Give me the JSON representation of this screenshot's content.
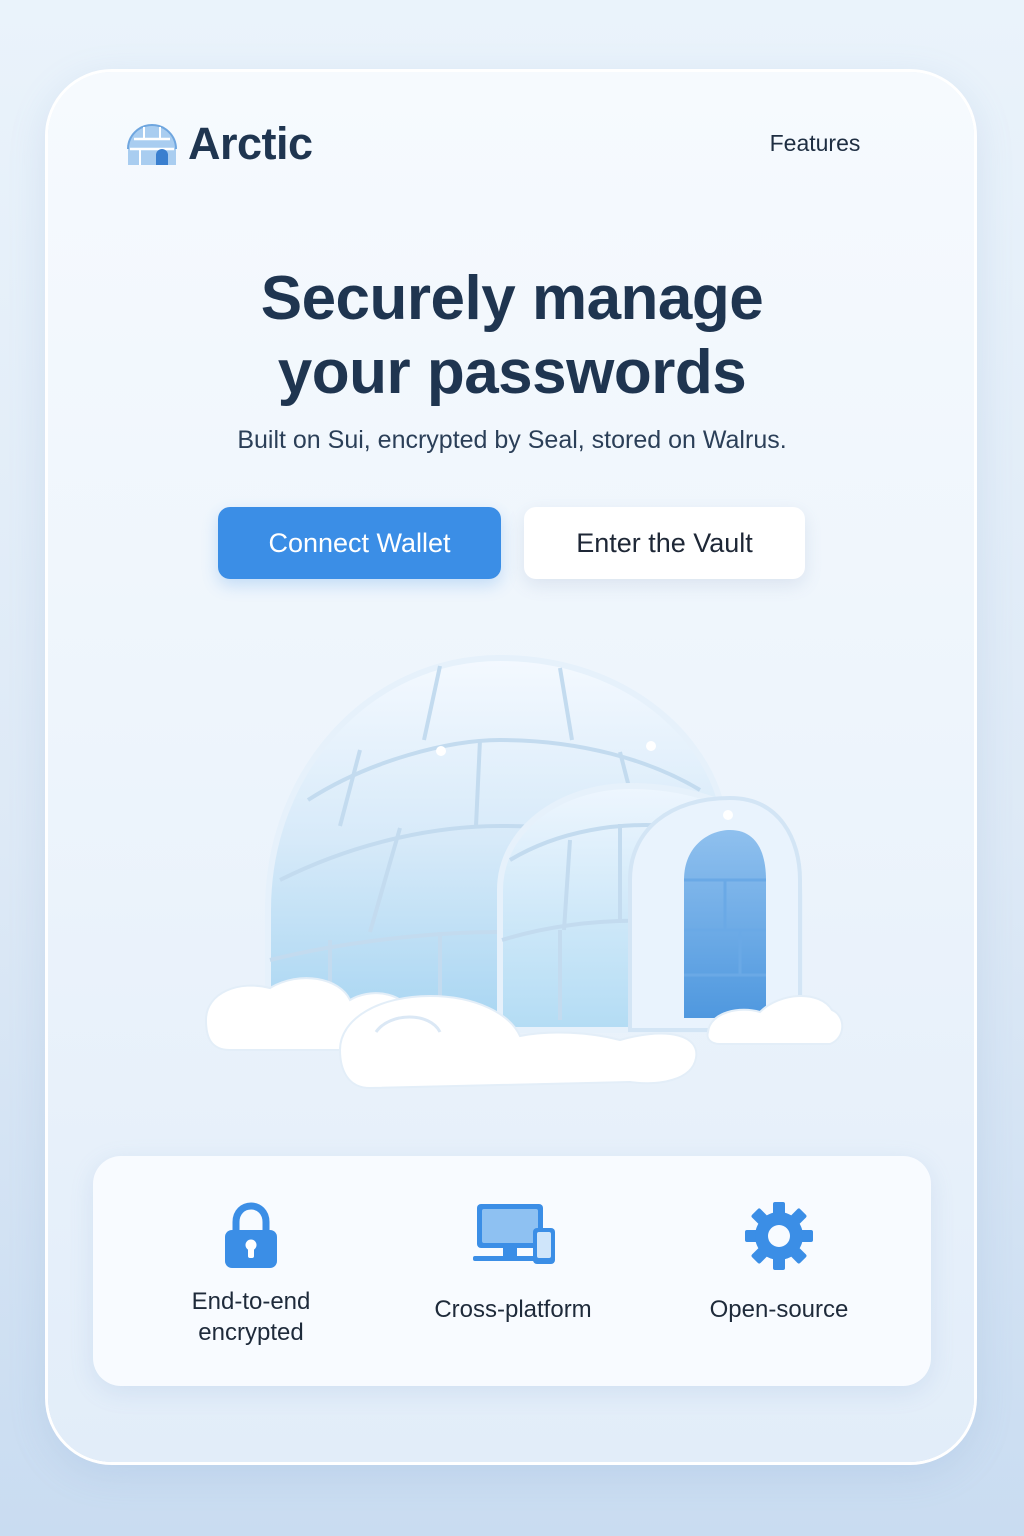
{
  "brand": {
    "name": "Arctic",
    "logo_icon": "igloo-logo-icon"
  },
  "nav": {
    "features_label": "Features"
  },
  "hero": {
    "title_line1": "Securely manage",
    "title_line2": "your passwords",
    "subtitle": "Built on Sui, encrypted by Seal, stored on Walrus."
  },
  "actions": {
    "primary_label": "Connect Wallet",
    "secondary_label": "Enter the Vault"
  },
  "illustration": {
    "icon": "igloo-illustration"
  },
  "features": [
    {
      "icon": "lock-icon",
      "label": "End-to-end encrypted",
      "line1": "End-to-end",
      "line2": "encrypted"
    },
    {
      "icon": "devices-icon",
      "label": "Cross-platform"
    },
    {
      "icon": "gear-icon",
      "label": "Open-source"
    }
  ],
  "colors": {
    "accent": "#3b8ee6",
    "heading": "#1f3550",
    "background": "#e4eef8"
  }
}
